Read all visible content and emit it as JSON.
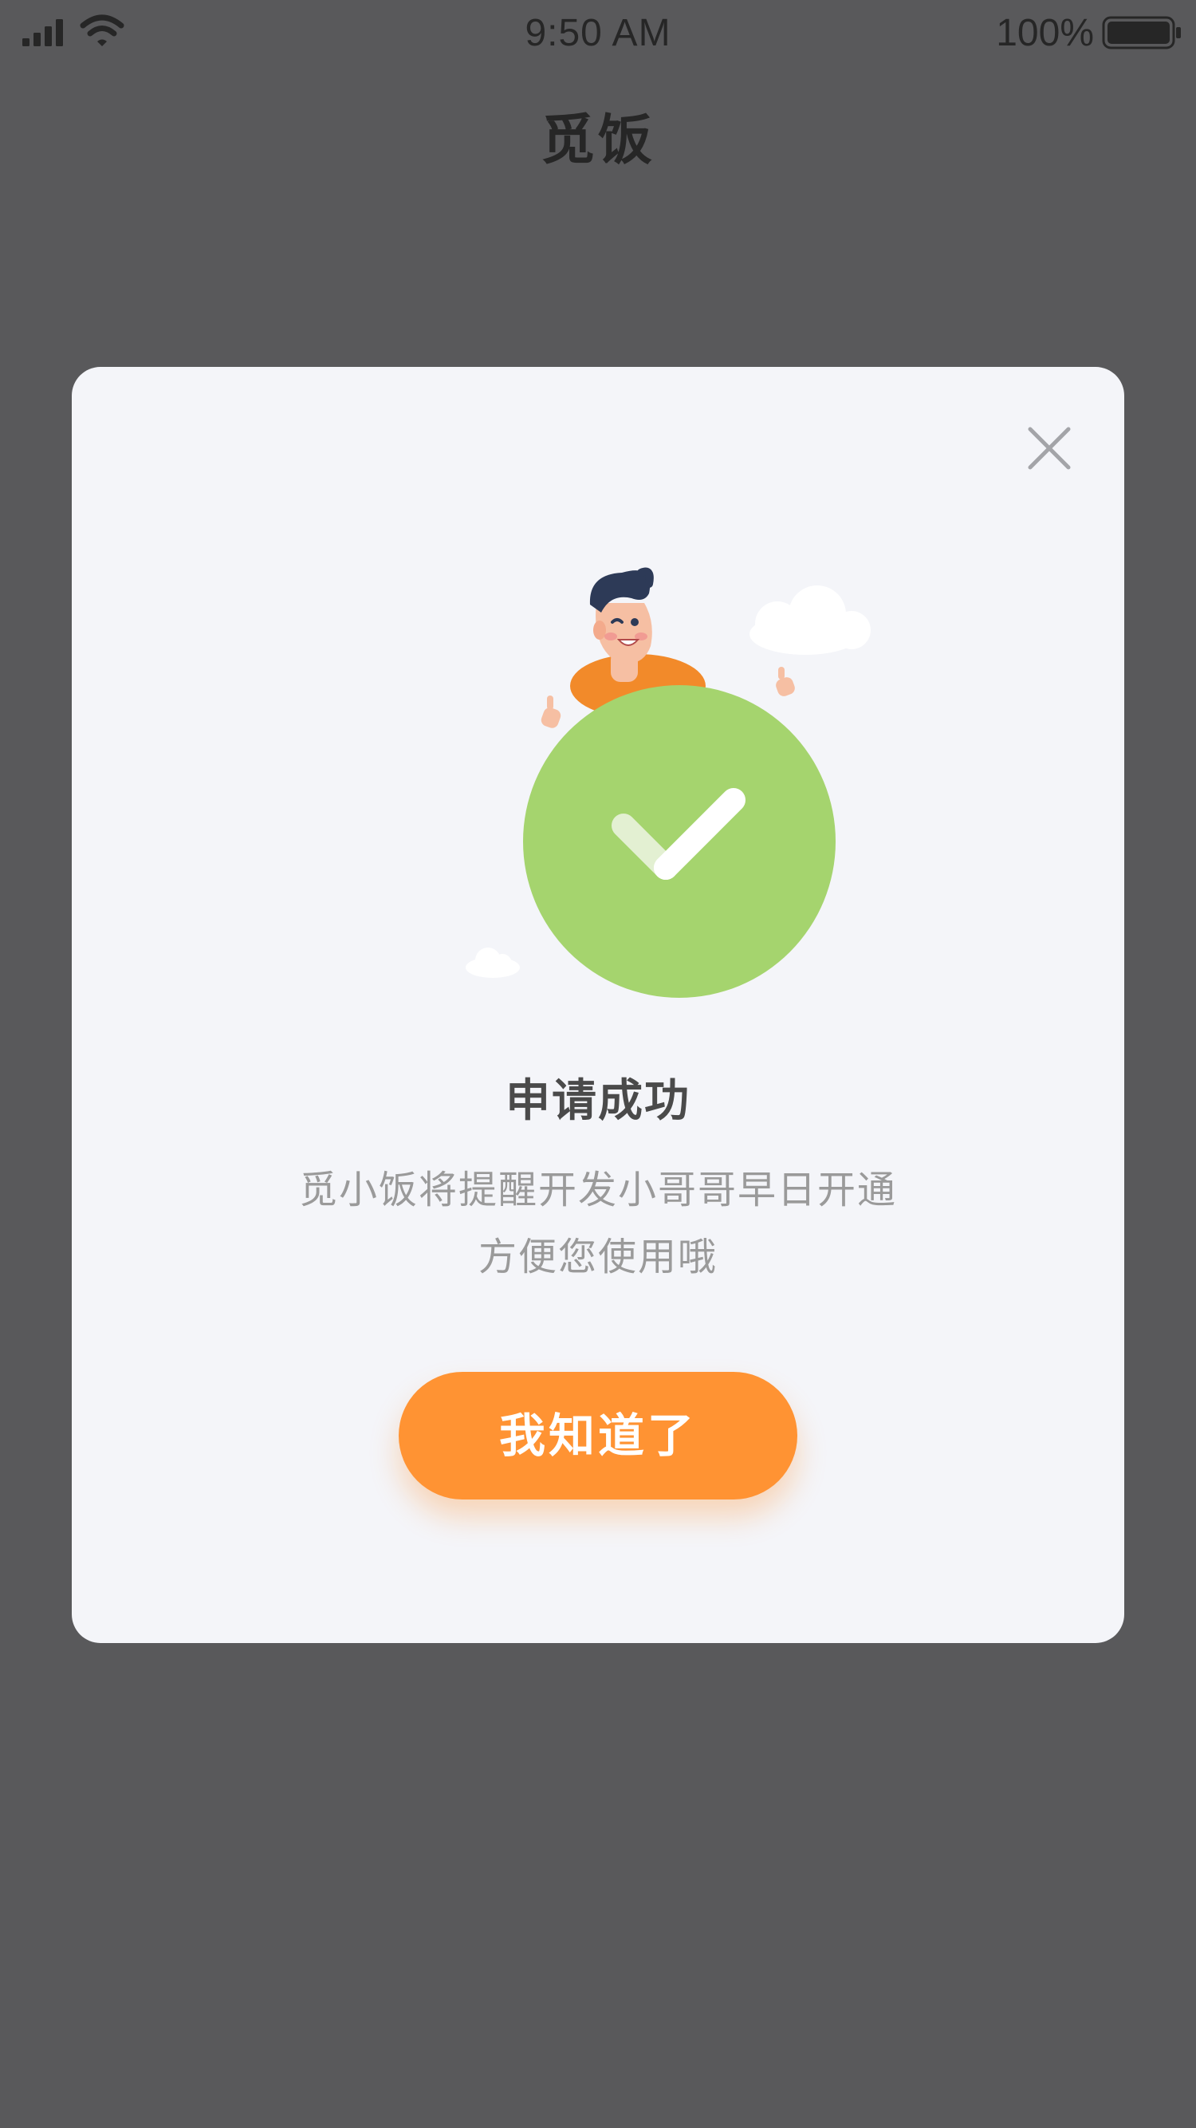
{
  "status_bar": {
    "time": "9:50 AM",
    "battery": "100%",
    "icons": [
      "signal-icon",
      "wifi-icon",
      "battery-icon"
    ]
  },
  "nav": {
    "title": "觅饭"
  },
  "dialog": {
    "close_icon": "close-icon",
    "illustration": "success-check-illustration",
    "title": "申请成功",
    "message_line1": "觅小饭将提醒开发小哥哥早日开通",
    "message_line2": "方便您使用哦",
    "confirm_label": "我知道了"
  },
  "colors": {
    "overlay": "#59595b",
    "dialog_bg": "#f4f5f9",
    "accent_orange": "#ff9333",
    "success_green": "#a5d46e",
    "title_text": "#4a4a4a",
    "body_text": "#9a9a9a"
  }
}
